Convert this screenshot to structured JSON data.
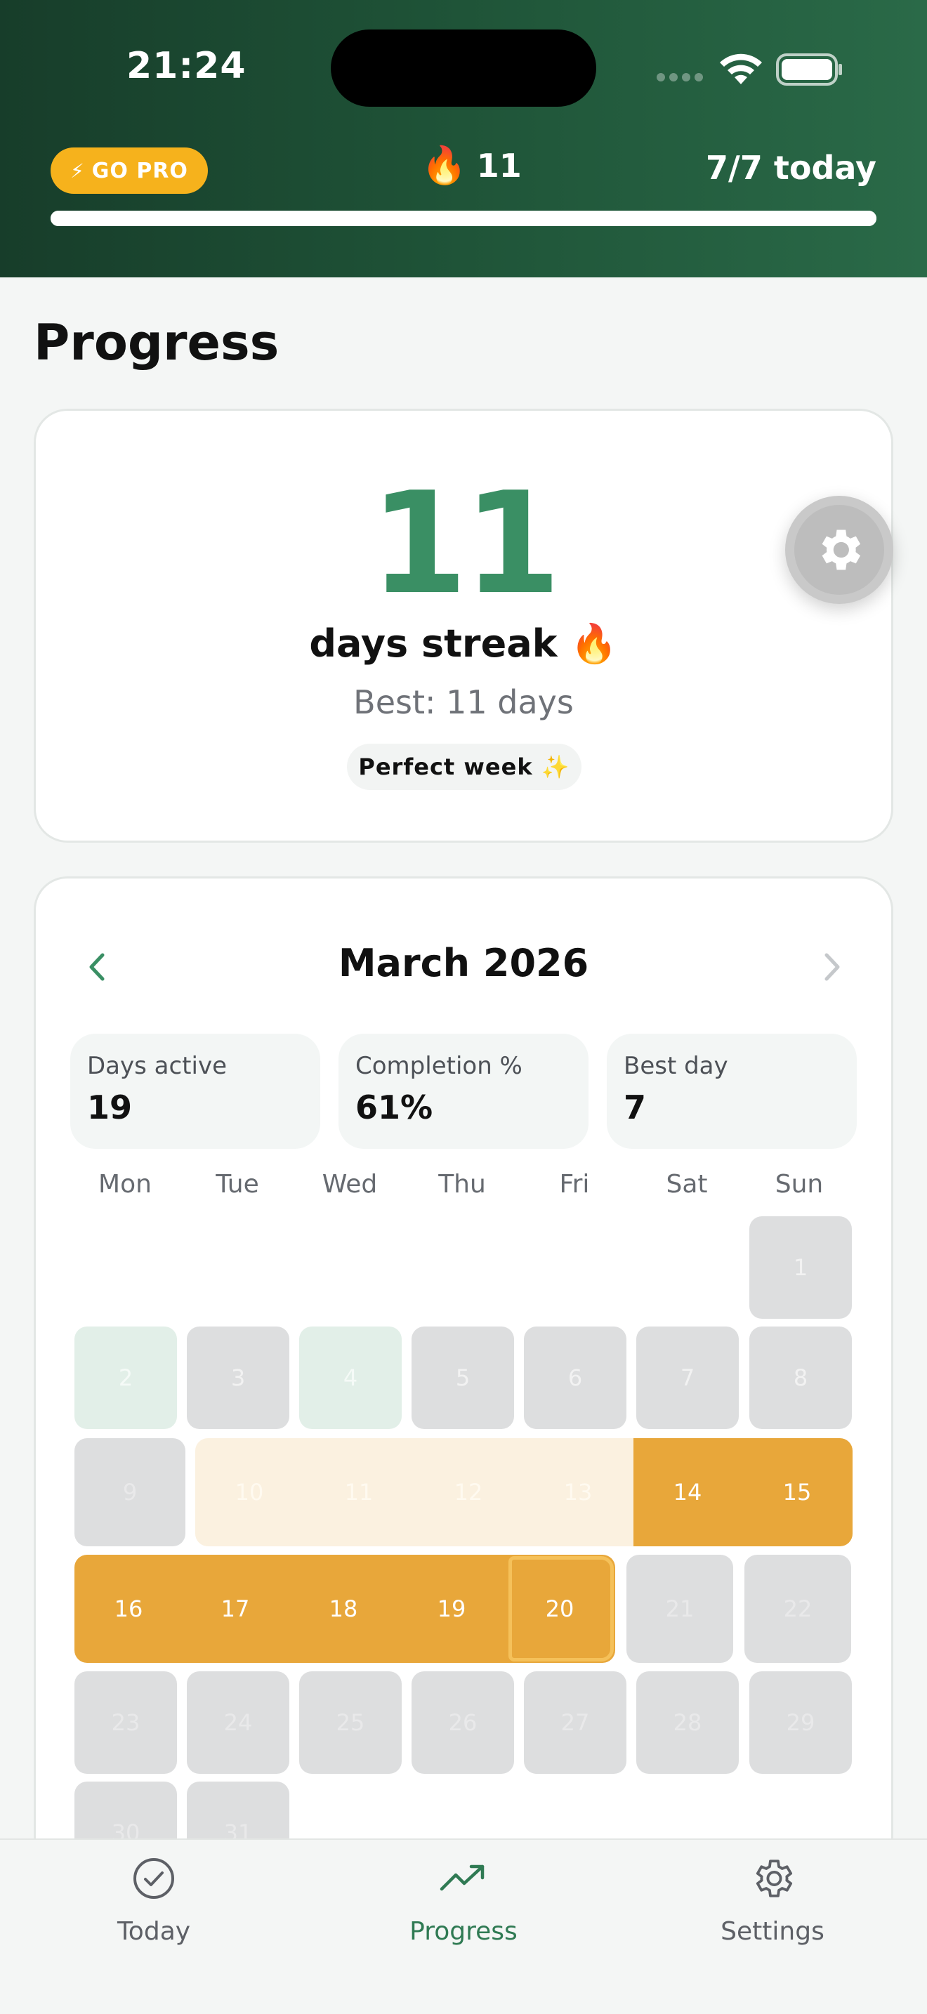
{
  "status_bar": {
    "time": "21:24"
  },
  "header": {
    "go_pro_label": "GO PRO",
    "streak_count": "11",
    "today_progress": "7/7 today",
    "progress_fraction": 1.0,
    "accent": "#f6b21c"
  },
  "page": {
    "title": "Progress"
  },
  "streak_card": {
    "number": "11",
    "label": "days streak 🔥",
    "best": "Best: 11 days",
    "badge": "Perfect week ✨"
  },
  "calendar": {
    "month": "March 2026",
    "stats": [
      {
        "label": "Days active",
        "value": "19"
      },
      {
        "label": "Completion %",
        "value": "61%"
      },
      {
        "label": "Best day",
        "value": "7"
      }
    ],
    "weekdays": [
      "Mon",
      "Tue",
      "Wed",
      "Thu",
      "Fri",
      "Sat",
      "Sun"
    ],
    "days": [
      "1",
      "2",
      "3",
      "4",
      "5",
      "6",
      "7",
      "8",
      "9",
      "10",
      "11",
      "12",
      "13",
      "14",
      "15",
      "16",
      "17",
      "18",
      "19",
      "20",
      "21",
      "22",
      "23",
      "24",
      "25",
      "26",
      "27",
      "28",
      "29",
      "30",
      "31"
    ],
    "today": "20",
    "colors": {
      "streak": "#e8a73a",
      "week": "#fbf1e0",
      "active": "#e2efe8",
      "empty": "#dddedf"
    }
  },
  "tabs": [
    {
      "label": "Today",
      "icon": "check-circle-icon"
    },
    {
      "label": "Progress",
      "icon": "trend-up-icon"
    },
    {
      "label": "Settings",
      "icon": "gear-icon"
    }
  ]
}
